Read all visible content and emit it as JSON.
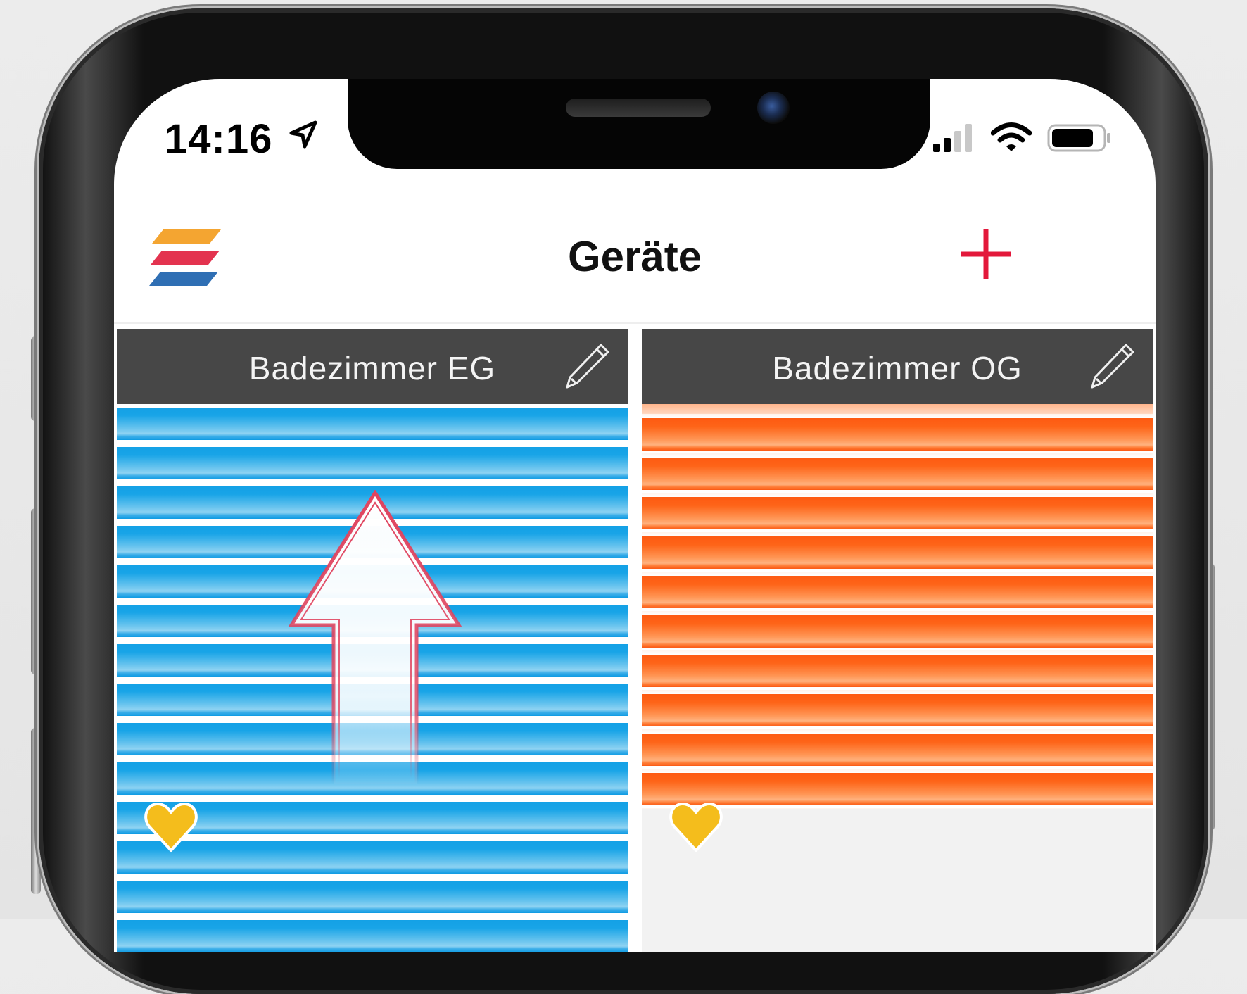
{
  "status_bar": {
    "time": "14:16"
  },
  "nav": {
    "title": "Geräte"
  },
  "devices": [
    {
      "name": "Badezimmer EG",
      "state_color": "#1aa3e6",
      "direction": "up"
    },
    {
      "name": "Badezimmer OG",
      "state_color": "#fe5e16"
    }
  ],
  "colors": {
    "accent": "#e3183b",
    "logo": [
      "#f4a531",
      "#e3334f",
      "#2f6fb4"
    ],
    "favorite": "#f4bd1c",
    "tile_header": "#474747"
  }
}
